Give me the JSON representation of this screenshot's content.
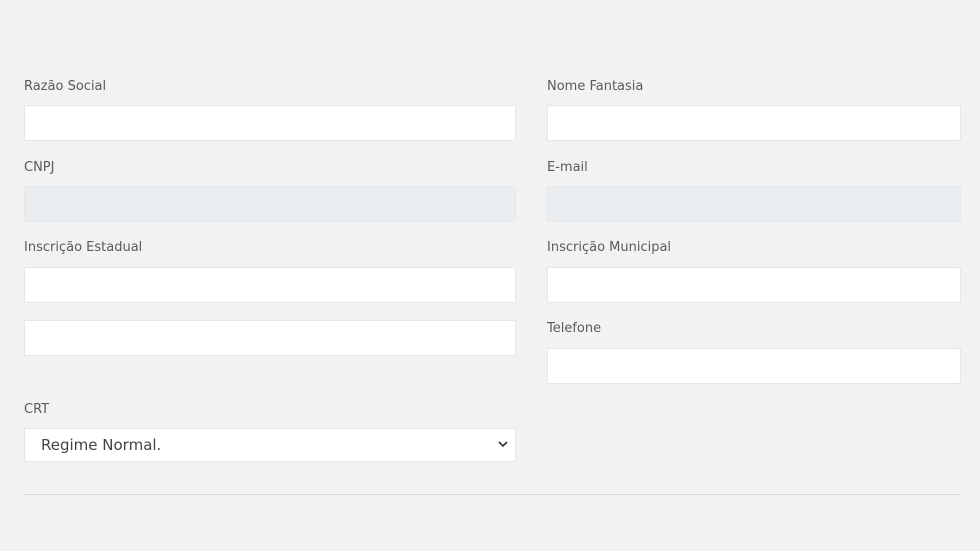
{
  "form": {
    "razao_social": {
      "label": "Razão Social",
      "value": ""
    },
    "nome_fantasia": {
      "label": "Nome Fantasia",
      "value": ""
    },
    "cnpj": {
      "label": "CNPJ",
      "value": ""
    },
    "email": {
      "label": "E-mail",
      "value": ""
    },
    "inscricao_estadual": {
      "label": "Inscrição Estadual",
      "value": ""
    },
    "inscricao_municipal": {
      "label": "Inscrição Municipal",
      "value": ""
    },
    "extra_field": {
      "value": ""
    },
    "telefone": {
      "label": "Telefone",
      "value": ""
    },
    "crt": {
      "label": "CRT",
      "selected": "Regime Normal."
    }
  },
  "icons": {
    "select_arrow": "chevron-down-icon"
  }
}
